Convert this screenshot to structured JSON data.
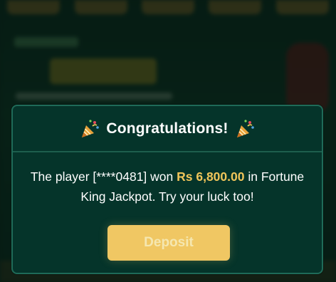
{
  "dialog": {
    "title": "Congratulations!",
    "message_prefix": "The player [****0481] won ",
    "amount": "Rs 6,800.00",
    "message_suffix": " in Fortune King Jackpot. Try your luck too!",
    "deposit_label": "Deposit"
  },
  "colors": {
    "dialog_bg": "#05342a",
    "dialog_border": "#1f6b58",
    "amount_gold": "#f0c55a",
    "button_bg": "#f0c763"
  },
  "icons": {
    "left": "party-popper-icon",
    "right": "party-popper-icon"
  }
}
